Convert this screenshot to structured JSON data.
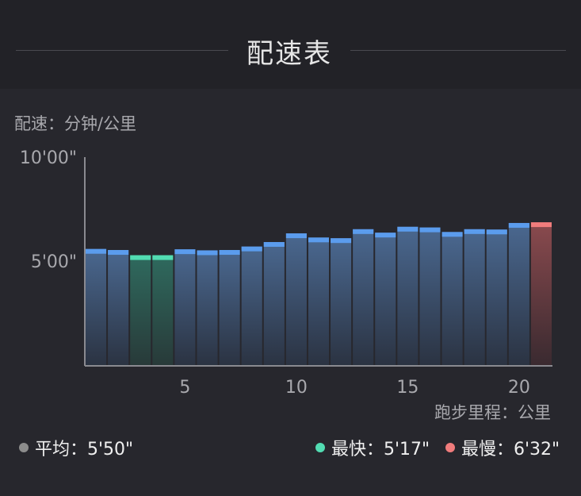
{
  "header": {
    "title": "配速表"
  },
  "chart_data": {
    "type": "bar",
    "ylabel": "配速：分钟/公里",
    "xlabel": "跑步里程：公里",
    "x": [
      1,
      2,
      3,
      4,
      5,
      6,
      7,
      8,
      9,
      10,
      11,
      12,
      13,
      14,
      15,
      16,
      17,
      18,
      19,
      20,
      21
    ],
    "values_seconds": [
      335,
      332,
      317,
      317,
      334,
      331,
      332,
      342,
      355,
      380,
      368,
      366,
      392,
      382,
      399,
      397,
      384,
      392,
      391,
      410,
      412
    ],
    "ylim_seconds": [
      0,
      600
    ],
    "y_ticks": [
      {
        "value": 300,
        "label": "5'00\""
      },
      {
        "value": 600,
        "label": "10'00\""
      }
    ],
    "x_ticks": [
      {
        "value": 5,
        "label": "5"
      },
      {
        "value": 10,
        "label": "10"
      },
      {
        "value": 15,
        "label": "15"
      },
      {
        "value": 20,
        "label": "20"
      }
    ],
    "fastest_indices": [
      2,
      3
    ],
    "slowest_indices": [
      20
    ],
    "colors": {
      "normal": "#5b9ced",
      "fast": "#52dcb2",
      "slow": "#f07c7c",
      "axis": "#8a8a90"
    }
  },
  "stats": {
    "avg": {
      "label": "平均：5'50\"",
      "color": "#8c8c8c"
    },
    "fast": {
      "label": "最快：5'17\"",
      "color": "#52dcb2"
    },
    "slow": {
      "label": "最慢：6'32\"",
      "color": "#f07c7c"
    }
  }
}
